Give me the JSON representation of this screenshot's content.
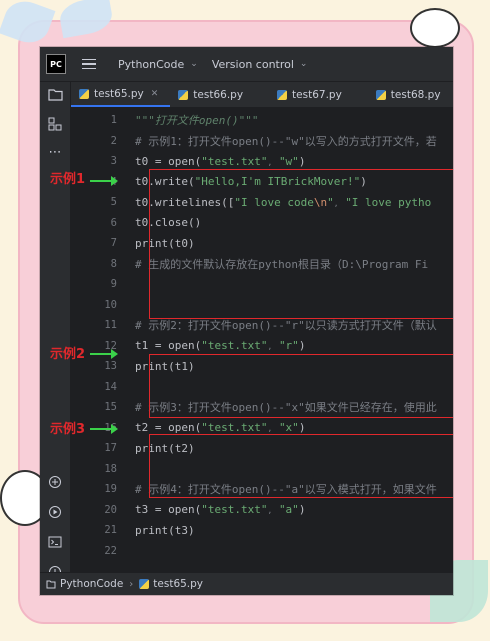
{
  "app": {
    "project_menu": "PythonCode",
    "vcs_menu": "Version control",
    "logo_text": "PC"
  },
  "tabs": [
    {
      "label": "test65.py",
      "active": true
    },
    {
      "label": "test66.py",
      "active": false
    },
    {
      "label": "test67.py",
      "active": false
    },
    {
      "label": "test68.py",
      "active": false
    }
  ],
  "code_lines": [
    {
      "n": "1",
      "text": "\"\"\"打开文件open()\"\"\""
    },
    {
      "n": "2",
      "text": "# 示例1：打开文件open()--\"w\"以写入的方式打开文件，若"
    },
    {
      "n": "3",
      "text": "t0 = open(\"test.txt\", \"w\")"
    },
    {
      "n": "4",
      "text": "t0.write(\"Hello,I'm ITBrickMover!\")"
    },
    {
      "n": "5",
      "text": "t0.writelines([\"I love code\\n\", \"I love pytho"
    },
    {
      "n": "6",
      "text": "t0.close()"
    },
    {
      "n": "7",
      "text": "print(t0)"
    },
    {
      "n": "8",
      "text": "# 生成的文件默认存放在python根目录（D:\\Program Fi"
    },
    {
      "n": "9",
      "text": ""
    },
    {
      "n": "10",
      "text": ""
    },
    {
      "n": "11",
      "text": "# 示例2：打开文件open()--\"r\"以只读方式打开文件（默认"
    },
    {
      "n": "12",
      "text": "t1 = open(\"test.txt\", \"r\")"
    },
    {
      "n": "13",
      "text": "print(t1)"
    },
    {
      "n": "14",
      "text": ""
    },
    {
      "n": "15",
      "text": "# 示例3：打开文件open()--\"x\"如果文件已经存在，使用此"
    },
    {
      "n": "16",
      "text": "t2 = open(\"test.txt\", \"x\")"
    },
    {
      "n": "17",
      "text": "print(t2)"
    },
    {
      "n": "18",
      "text": ""
    },
    {
      "n": "19",
      "text": "# 示例4：打开文件open()--\"a\"以写入模式打开，如果文件"
    },
    {
      "n": "20",
      "text": "t3 = open(\"test.txt\", \"a\")"
    },
    {
      "n": "21",
      "text": "print(t3)"
    },
    {
      "n": "22",
      "text": ""
    }
  ],
  "annotations": [
    {
      "label": "示例1"
    },
    {
      "label": "示例2"
    },
    {
      "label": "示例3"
    }
  ],
  "statusbar": {
    "project": "PythonCode",
    "file": "test65.py"
  },
  "colors": {
    "annotation_red": "#e0282c",
    "arrow_green": "#3bd14a",
    "editor_bg": "#1e1f22",
    "string_green": "#6aab73",
    "comment_gray": "#7a7e85"
  }
}
